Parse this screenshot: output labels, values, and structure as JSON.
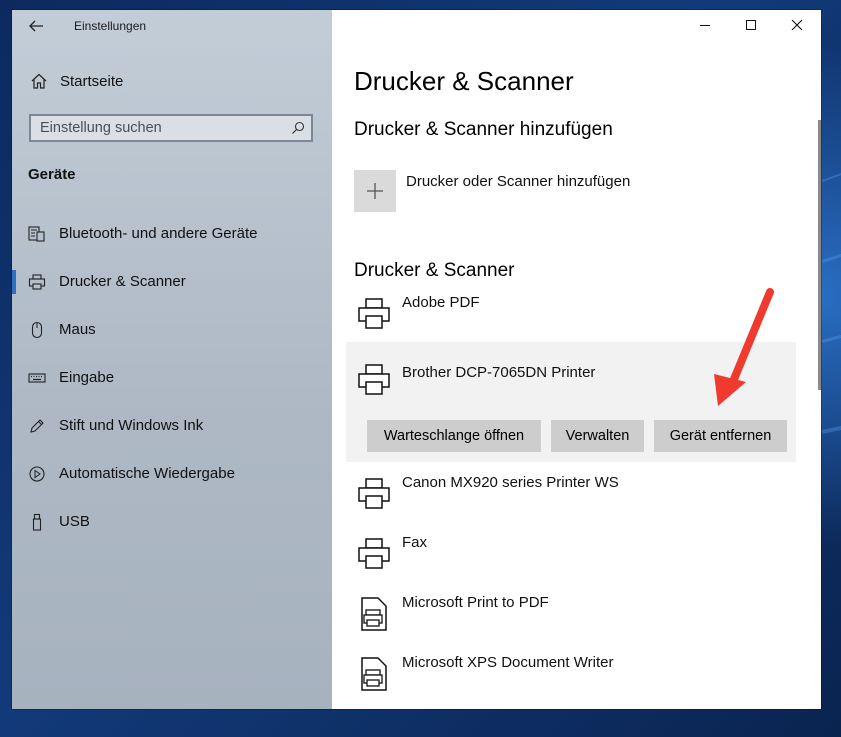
{
  "window": {
    "app_title": "Einstellungen"
  },
  "sidebar": {
    "home_label": "Startseite",
    "search_placeholder": "Einstellung suchen",
    "section_label": "Geräte",
    "items": [
      {
        "label": "Bluetooth- und andere Geräte",
        "icon": "bluetooth-devices-icon"
      },
      {
        "label": "Drucker & Scanner",
        "icon": "printer-icon",
        "active": true
      },
      {
        "label": "Maus",
        "icon": "mouse-icon"
      },
      {
        "label": "Eingabe",
        "icon": "keyboard-icon"
      },
      {
        "label": "Stift und Windows Ink",
        "icon": "pen-icon"
      },
      {
        "label": "Automatische Wiedergabe",
        "icon": "autoplay-icon"
      },
      {
        "label": "USB",
        "icon": "usb-icon"
      }
    ]
  },
  "main": {
    "title": "Drucker & Scanner",
    "add_heading": "Drucker & Scanner hinzufügen",
    "add_label": "Drucker oder Scanner hinzufügen",
    "list_heading": "Drucker & Scanner",
    "devices": [
      {
        "name": "Adobe PDF",
        "icon": "printer-icon"
      },
      {
        "name": "Brother DCP-7065DN Printer",
        "icon": "printer-icon",
        "selected": true
      },
      {
        "name": "Canon MX920 series Printer WS",
        "icon": "printer-icon"
      },
      {
        "name": "Fax",
        "icon": "printer-icon"
      },
      {
        "name": "Microsoft Print to PDF",
        "icon": "document-printer-icon"
      },
      {
        "name": "Microsoft XPS Document Writer",
        "icon": "document-printer-icon"
      }
    ],
    "actions": {
      "open_queue": "Warteschlange öffnen",
      "manage": "Verwalten",
      "remove": "Gerät entfernen"
    }
  },
  "colors": {
    "accent": "#2e6fbf",
    "annotation_arrow": "#f03a2e"
  }
}
